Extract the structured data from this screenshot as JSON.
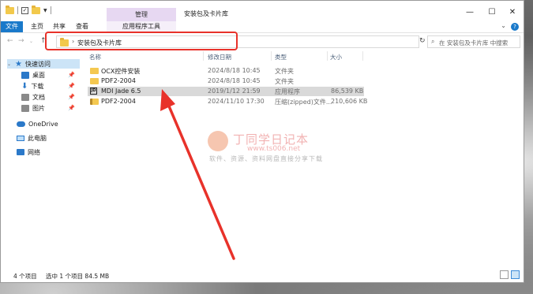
{
  "window": {
    "title": "安装包及卡片库",
    "tool_tab": "管理",
    "controls": {
      "minimize": "—",
      "maximize": "☐",
      "close": "✕"
    }
  },
  "ribbon": {
    "tabs": [
      "文件",
      "主页",
      "共享",
      "查看",
      "应用程序工具"
    ]
  },
  "address": {
    "crumb": "安装包及卡片库",
    "separator": "›",
    "search_placeholder": "在 安装包及卡片库 中搜索"
  },
  "sidebar": {
    "quick_access": "快速访问",
    "items": [
      "桌面",
      "下载",
      "文档",
      "图片"
    ],
    "onedrive": "OneDrive",
    "this_pc": "此电脑",
    "network": "网络"
  },
  "columns": {
    "name": "名称",
    "modified": "修改日期",
    "type": "类型",
    "size": "大小"
  },
  "files": [
    {
      "name": "OCX控件安装",
      "modified": "2024/8/18 10:45",
      "type": "文件夹",
      "size": "",
      "icon": "folder-icon"
    },
    {
      "name": "PDF2-2004",
      "modified": "2024/8/18 10:45",
      "type": "文件夹",
      "size": "",
      "icon": "folder-icon"
    },
    {
      "name": "MDI Jade 6.5",
      "modified": "2019/1/12 21:59",
      "type": "应用程序",
      "size": "86,539 KB",
      "icon": "app-icon",
      "selected": true
    },
    {
      "name": "PDF2-2004",
      "modified": "2024/11/10 17:30",
      "type": "压缩(zipped)文件...",
      "size": "210,606 KB",
      "icon": "zip-folder-icon"
    }
  ],
  "watermark": {
    "title": "丁同学日记本",
    "url": "www.ts006.net",
    "subtitle": "软件、资源、资料网盘直接分享下载"
  },
  "status": {
    "count": "4 个项目",
    "selected": "选中 1 个项目 84.5 MB"
  },
  "colors": {
    "accent": "#1979ca",
    "highlight": "#e8322a",
    "selected_row": "#d9d9d9"
  }
}
